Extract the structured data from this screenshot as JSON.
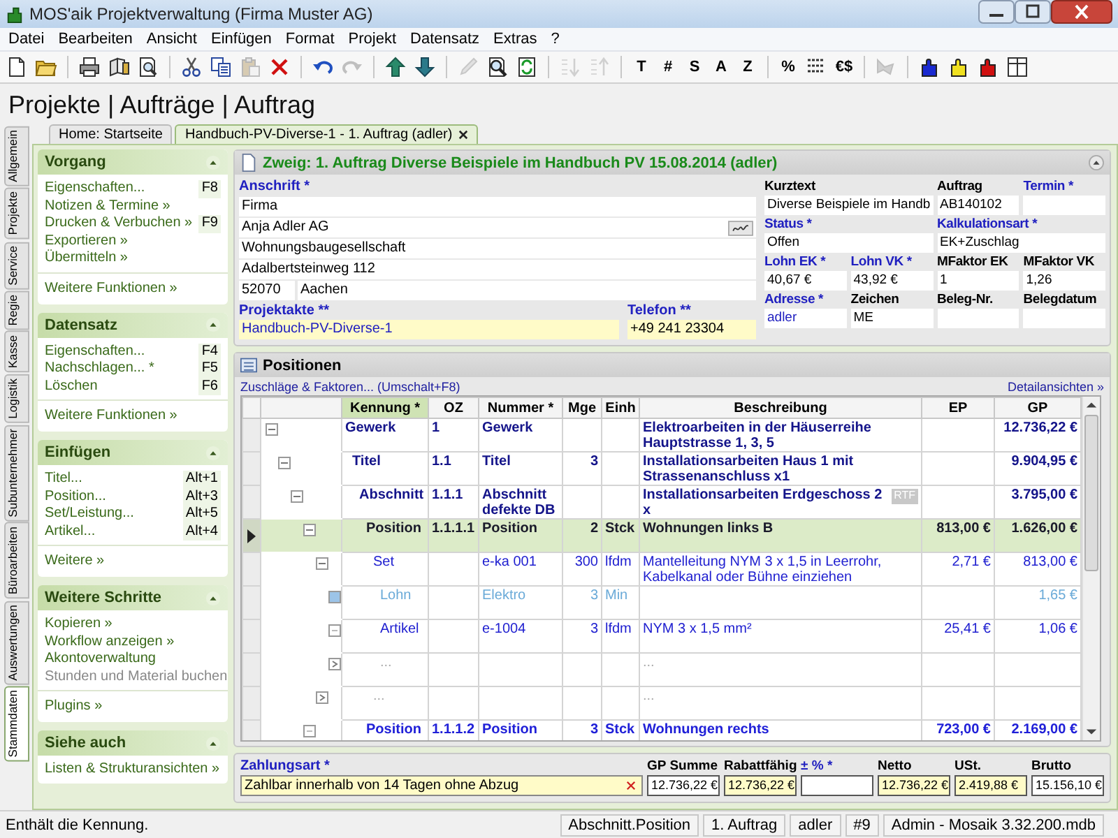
{
  "window": {
    "title": "MOS'aik Projektverwaltung (Firma Muster AG)"
  },
  "menu": [
    "Datei",
    "Bearbeiten",
    "Ansicht",
    "Einfügen",
    "Format",
    "Projekt",
    "Datensatz",
    "Extras",
    "?"
  ],
  "toolbar": [
    [
      {
        "kind": "icon",
        "disabled": false
      },
      {
        "kind": "icon",
        "disabled": false
      }
    ],
    [
      {
        "kind": "icon",
        "disabled": false
      },
      {
        "kind": "icon",
        "disabled": false
      },
      {
        "kind": "icon",
        "disabled": false
      }
    ],
    [
      {
        "kind": "icon",
        "disabled": false
      },
      {
        "kind": "icon",
        "disabled": false
      },
      {
        "kind": "icon",
        "disabled": true
      },
      {
        "kind": "icon",
        "disabled": false
      }
    ],
    [
      {
        "kind": "icon",
        "disabled": false
      },
      {
        "kind": "icon",
        "disabled": true
      }
    ],
    [
      {
        "kind": "icon",
        "disabled": false
      },
      {
        "kind": "icon",
        "disabled": false
      }
    ],
    [
      {
        "kind": "icon",
        "disabled": true
      },
      {
        "kind": "icon",
        "disabled": false
      },
      {
        "kind": "icon",
        "disabled": false
      }
    ],
    [
      {
        "kind": "icon",
        "disabled": true
      },
      {
        "kind": "icon",
        "disabled": true
      }
    ],
    [
      {
        "kind": "glyph",
        "text": "T"
      },
      {
        "kind": "glyph",
        "text": "#"
      },
      {
        "kind": "glyph",
        "text": "S"
      },
      {
        "kind": "glyph",
        "text": "A"
      },
      {
        "kind": "glyph",
        "text": "Z"
      }
    ],
    [
      {
        "kind": "glyph",
        "text": "%"
      },
      {
        "kind": "icon",
        "disabled": false
      },
      {
        "kind": "glyph",
        "text": "€$"
      }
    ],
    [
      {
        "kind": "icon",
        "disabled": true
      }
    ],
    [
      {
        "kind": "icon",
        "disabled": false
      },
      {
        "kind": "icon",
        "disabled": false
      },
      {
        "kind": "icon",
        "disabled": false
      },
      {
        "kind": "icon",
        "disabled": false
      }
    ]
  ],
  "heading": "Projekte | Aufträge | Auftrag",
  "side_tabs": [
    {
      "label": "Allgemein",
      "selected": false
    },
    {
      "label": "Projekte",
      "selected": false
    },
    {
      "label": "Service",
      "selected": false
    },
    {
      "label": "Regie",
      "selected": false
    },
    {
      "label": "Kasse",
      "selected": false
    },
    {
      "label": "Logistik",
      "selected": false
    },
    {
      "label": "Subunternehmer",
      "selected": false
    },
    {
      "label": "Büroarbeiten",
      "selected": false
    },
    {
      "label": "Auswertungen",
      "selected": false
    },
    {
      "label": "Stammdaten",
      "selected": true
    }
  ],
  "doc_tabs": [
    {
      "label": "Home: Startseite",
      "selected": false,
      "closable": false
    },
    {
      "label": "Handbuch-PV-Diverse-1 - 1. Auftrag (adler)",
      "selected": true,
      "closable": true
    }
  ],
  "sidebar": [
    {
      "title": "Vorgang",
      "items": [
        {
          "label": "Eigenschaften...",
          "shortcut": "F8",
          "disabled": false
        },
        {
          "label": "Notizen & Termine »",
          "disabled": false
        },
        {
          "label": "Drucken & Verbuchen »",
          "shortcut": "F9",
          "disabled": false
        },
        {
          "label": "Exportieren »",
          "disabled": false
        },
        {
          "label": "Übermitteln »",
          "disabled": false
        }
      ],
      "footer": "Weitere Funktionen »"
    },
    {
      "title": "Datensatz",
      "items": [
        {
          "label": "Eigenschaften...",
          "shortcut": "F4",
          "disabled": false
        },
        {
          "label": "Nachschlagen... *",
          "shortcut": "F5",
          "disabled": false
        },
        {
          "label": "Löschen",
          "shortcut": "F6",
          "disabled": false
        }
      ],
      "footer": "Weitere Funktionen »"
    },
    {
      "title": "Einfügen",
      "items": [
        {
          "label": "Titel...",
          "shortcut": "Alt+1",
          "disabled": false
        },
        {
          "label": "Position...",
          "shortcut": "Alt+3",
          "disabled": false
        },
        {
          "label": "Set/Leistung...",
          "shortcut": "Alt+5",
          "disabled": false
        },
        {
          "label": "Artikel...",
          "shortcut": "Alt+4",
          "disabled": false
        }
      ],
      "footer": "Weitere »"
    },
    {
      "title": "Weitere Schritte",
      "items": [
        {
          "label": "Kopieren »",
          "disabled": false
        },
        {
          "label": "Workflow anzeigen »",
          "disabled": false
        },
        {
          "label": "Akontoverwaltung",
          "disabled": false
        },
        {
          "label": "Stunden und Material buchen",
          "disabled": true
        }
      ],
      "footer": "Plugins »"
    },
    {
      "title": "Siehe auch",
      "items": [
        {
          "label": "Listen & Strukturansichten »",
          "disabled": false
        }
      ]
    }
  ],
  "record": {
    "title": "Zweig: 1. Auftrag Diverse Beispiele im Handbuch PV 15.08.2014 (adler)",
    "address_label": "Anschrift *",
    "address_lines": [
      "Firma",
      "Anja Adler AG",
      "Wohnungsbaugesellschaft",
      "Adalbertsteinweg 112"
    ],
    "zip": "52070",
    "city": "Aachen",
    "bottom_fields": [
      {
        "label": "Projektakte **",
        "value": "Handbuch-PV-Diverse-1",
        "label_link": true,
        "value_link": true,
        "highlighted": true
      },
      {
        "label": "Telefon **",
        "value": "+49 241 23304",
        "label_link": true,
        "value_link": false,
        "highlighted": true
      }
    ],
    "grid": [
      [
        {
          "label": "Kurztext",
          "value": "Diverse Beispiele im Handb",
          "label_link": false,
          "value_link": false,
          "highlighted": false
        },
        {
          "label": "Auftrag",
          "value": "AB140102",
          "label_link": false,
          "value_link": false,
          "highlighted": false
        },
        {
          "label": "Termin *",
          "label_link": true,
          "highlighted": false
        }
      ],
      [
        {
          "label": "Status *",
          "value": "Offen",
          "label_link": true,
          "value_link": false,
          "highlighted": false
        },
        {
          "label": "Kalkulationsart *",
          "value": "EK+Zuschlag",
          "label_link": true,
          "value_link": false,
          "highlighted": false
        }
      ],
      [
        {
          "label": "Lohn EK *",
          "value": "40,67 €",
          "label_link": true,
          "value_link": false,
          "highlighted": false
        },
        {
          "label": "Lohn VK *",
          "value": "43,92 €",
          "label_link": true,
          "value_link": false,
          "highlighted": false
        },
        {
          "label": "MFaktor EK",
          "value": "1",
          "label_link": false,
          "value_link": false,
          "highlighted": false
        },
        {
          "label": "MFaktor VK",
          "value": "1,26",
          "label_link": false,
          "value_link": false,
          "highlighted": false
        }
      ],
      [
        {
          "label": "Adresse *",
          "value": "adler",
          "label_link": true,
          "value_link": true,
          "highlighted": false
        },
        {
          "label": "Zeichen",
          "value": "ME",
          "label_link": false,
          "value_link": false,
          "highlighted": false
        },
        {
          "label": "Beleg-Nr.",
          "label_link": false,
          "highlighted": false
        },
        {
          "label": "Belegdatum",
          "label_link": false,
          "highlighted": false
        }
      ]
    ]
  },
  "positions": {
    "title": "Positionen",
    "left_link": "Zuschläge & Faktoren... (Umschalt+F8)",
    "right_link": "Detailansichten »",
    "columns": [
      {
        "label": "Kennung *",
        "selected": true
      },
      {
        "label": "OZ",
        "selected": false
      },
      {
        "label": "Nummer *",
        "selected": false
      },
      {
        "label": "Mge",
        "selected": false
      },
      {
        "label": "Einh",
        "selected": false
      },
      {
        "label": "Beschreibung",
        "selected": false
      },
      {
        "label": "EP",
        "selected": false
      },
      {
        "label": "GP",
        "selected": false
      }
    ],
    "rows": [
      {
        "kind": "gewerk",
        "kennung": "Gewerk",
        "oz": "1",
        "nummer": "Gewerk",
        "text": "Elektroarbeiten in der Häuserreihe Hauptstrasse 1, 3, 5",
        "gp": "12.736,22 €",
        "selected": false,
        "expanded": true,
        "children": [
          {
            "kind": "titel",
            "kennung": "Titel",
            "oz": "1.1",
            "nummer": "Titel",
            "mge": "3",
            "text": "Installationsarbeiten Haus 1 mit Strassenanschluss x1",
            "gp": "9.904,95 €",
            "selected": false,
            "expanded": true,
            "children": [
              {
                "kind": "abschnitt",
                "kennung": "Abschnitt",
                "oz": "1.1.1",
                "nummer": "Abschnitt defekte DB",
                "text": "Installationsarbeiten Erdgeschoss 2 x",
                "badge": "RTF",
                "gp": "3.795,00 €",
                "selected": false,
                "expanded": true,
                "children": [
                  {
                    "kind": "position",
                    "kennung": "Position",
                    "oz": "1.1.1.1",
                    "nummer": "Position",
                    "mge": "2",
                    "einh": "Stck",
                    "text": "Wohnungen links B",
                    "ep": "813,00 €",
                    "gp": "1.626,00 €",
                    "selected": true,
                    "expanded": true,
                    "children": [
                      {
                        "kind": "set",
                        "kennung": "Set",
                        "nummer": "e-ka 001",
                        "mge": "300",
                        "einh": "lfdm",
                        "text": "Mantelleitung NYM 3 x 1,5 in Leerrohr, Kabelkanal oder Bühne einziehen",
                        "ep": "2,71 €",
                        "gp": "813,00 €",
                        "selected": false,
                        "expanded": true,
                        "children": [
                          {
                            "kind": "lohn",
                            "kennung": "Lohn",
                            "nummer": "Elektro",
                            "mge": "3",
                            "einh": "Min",
                            "gp": "1,65 €",
                            "selected": false
                          },
                          {
                            "kind": "artikel",
                            "kennung": "Artikel",
                            "nummer": "e-1004",
                            "mge": "3",
                            "einh": "lfdm",
                            "text": "NYM 3 x 1,5 mm²",
                            "ep": "25,41 €",
                            "gp": "1,06 €",
                            "selected": false
                          },
                          {
                            "kind": "more",
                            "kennung": "...",
                            "text": "...",
                            "selected": false
                          }
                        ]
                      },
                      {
                        "kind": "more",
                        "kennung": "...",
                        "text": "...",
                        "selected": false
                      }
                    ]
                  },
                  {
                    "kind": "position",
                    "kennung": "Position",
                    "oz": "1.1.1.2",
                    "nummer": "Position",
                    "mge": "3",
                    "einh": "Stck",
                    "text": "Wohnungen rechts",
                    "ep": "723,00 €",
                    "gp": "2.169,00 €",
                    "selected": false
                  }
                ]
              }
            ]
          }
        ]
      }
    ]
  },
  "payment": {
    "label": "Zahlungsart *",
    "value": "Zahlbar innerhalb von 14 Tagen ohne Abzug"
  },
  "totals": [
    {
      "label": "GP Summe",
      "value": "12.736,22 €",
      "label_link": false,
      "highlighted": false
    },
    {
      "label": "Rabattfähig",
      "value": "12.736,22 €",
      "label_link": false,
      "highlighted": true
    },
    {
      "label": "± % *",
      "label_link": true,
      "highlighted": false
    },
    {
      "label": "Netto",
      "value": "12.736,22 €",
      "label_link": false,
      "highlighted": true
    },
    {
      "label": "USt.",
      "value": "2.419,88 €",
      "label_link": false,
      "highlighted": true
    },
    {
      "label": "Brutto",
      "value": "15.156,10 €",
      "label_link": false,
      "highlighted": false
    }
  ],
  "status_bar": {
    "message": "Enthält die Kennung.",
    "panels": [
      "Abschnitt.Position",
      "1. Auftrag",
      "adler",
      "#9",
      "Admin - Mosaik 3.32.200.mdb"
    ]
  }
}
